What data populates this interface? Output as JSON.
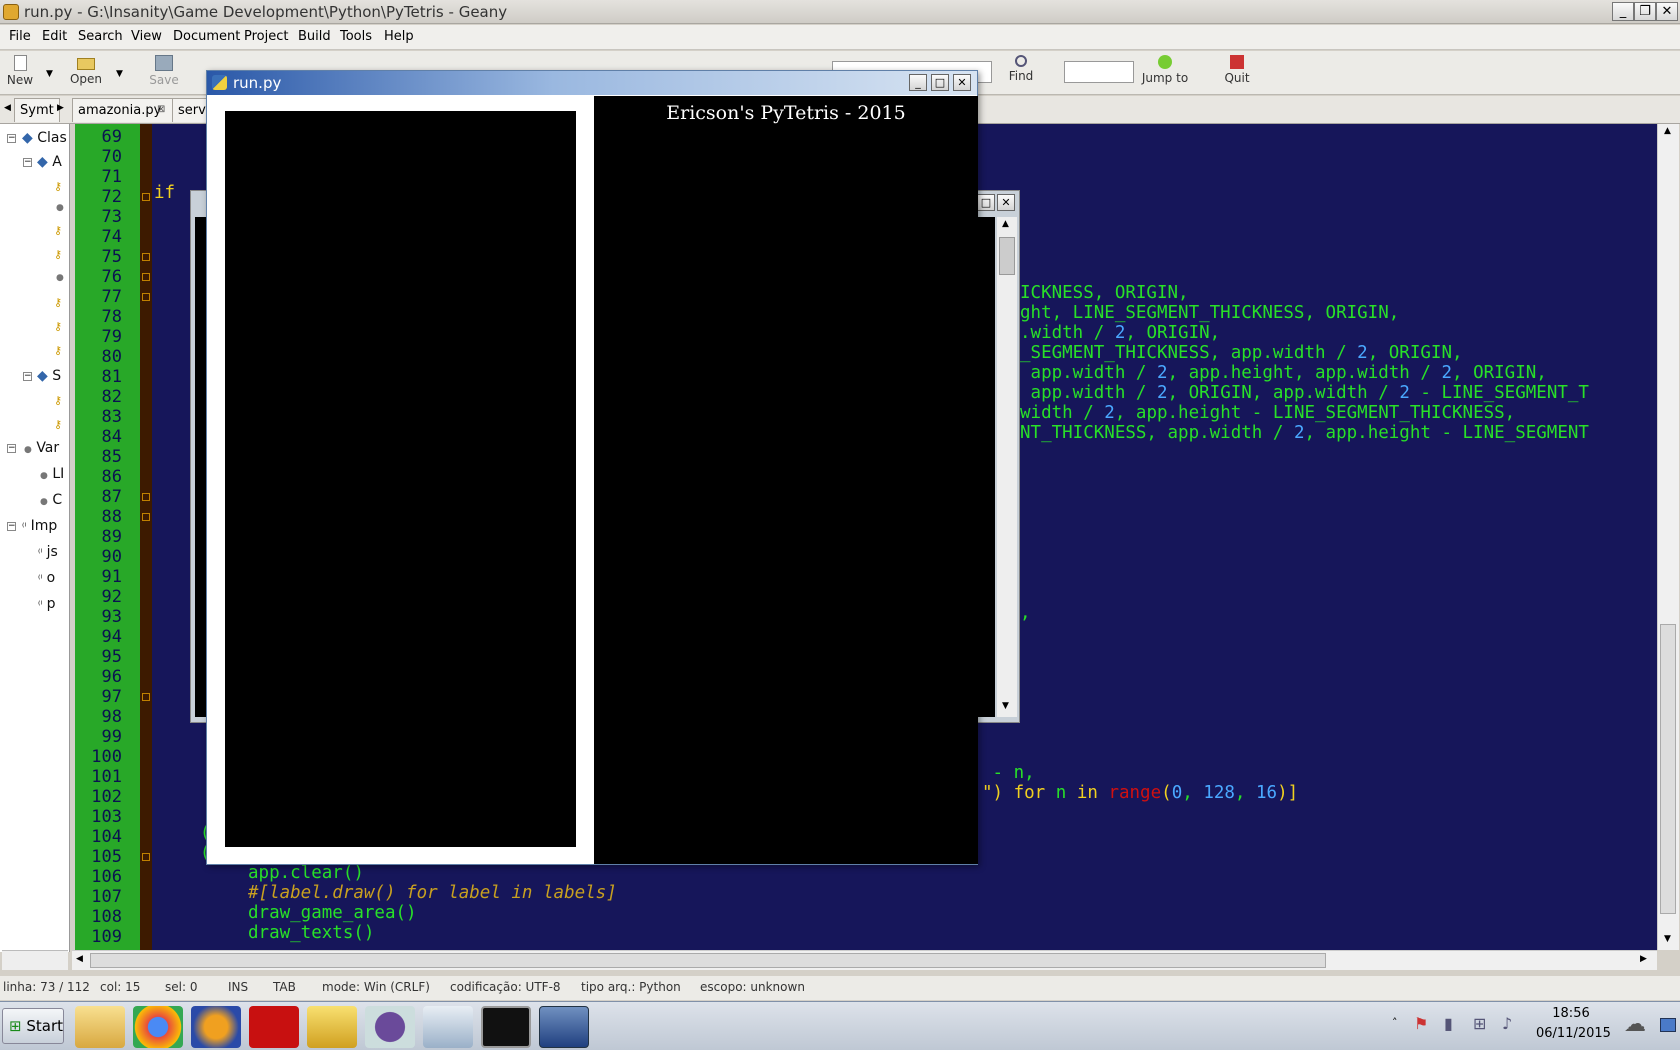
{
  "window": {
    "title": "run.py - G:\\Insanity\\Game Development\\Python\\PyTetris - Geany",
    "min": "_",
    "max": "❐",
    "close": "✕"
  },
  "menu": [
    "File",
    "Edit",
    "Search",
    "View",
    "Document",
    "Project",
    "Build",
    "Tools",
    "Help"
  ],
  "toolbar": {
    "new": "New",
    "open": "Open",
    "save": "Save",
    "find": "Find",
    "jump": "Jump to",
    "quit": "Quit"
  },
  "tabs": {
    "sidebar_tab": "Symt",
    "tab1": "amazonia.py",
    "tab2": "serv."
  },
  "sidebar": [
    "Clas",
    "A",
    "S",
    "Var",
    "LI",
    "C",
    "Imp",
    "js",
    "o",
    "p"
  ],
  "line_numbers": [
    "69",
    "70",
    "71",
    "72",
    "73",
    "74",
    "75",
    "76",
    "77",
    "78",
    "79",
    "80",
    "81",
    "82",
    "83",
    "84",
    "85",
    "86",
    "87",
    "88",
    "89",
    "90",
    "91",
    "92",
    "93",
    "94",
    "95",
    "96",
    "97",
    "98",
    "99",
    "100",
    "101",
    "102",
    "103",
    "104",
    "105",
    "106",
    "107",
    "108",
    "109"
  ],
  "code": {
    "l72": "if",
    "l77": "ICKNESS, ORIGIN,",
    "l78": "ght, LINE_SEGMENT_THICKNESS, ORIGIN,",
    "l79a": ".width / ",
    "l79b": "2",
    "l79c": ", ORIGIN,",
    "l80a": "_SEGMENT_THICKNESS, app.width / ",
    "l80b": "2",
    "l80c": ", ORIGIN,",
    "l81a": " app.width / ",
    "l81b": "2",
    "l81c": ", app.height, app.width / ",
    "l81d": "2",
    "l81e": ", ORIGIN,",
    "l82a": " app.width / ",
    "l82b": "2",
    "l82c": ", ORIGIN, app.width / ",
    "l82d": "2",
    "l82e": " - LINE_SEGMENT_T",
    "l83a": "width / ",
    "l83b": "2",
    "l83c": ", app.height - LINE_SEGMENT_THICKNESS,",
    "l84a": "NT_THICKNESS, app.width / ",
    "l84b": "2",
    "l84c": ", app.height - LINE_SEGMENT",
    "l94": ",",
    "l101": " - n,",
    "l102a": "\") ",
    "l102b": "for",
    "l102c": " n ",
    "l102d": "in",
    "l102e": " ",
    "l102f": "range",
    "l102g": "(",
    "l102h": "0",
    "l102i": ", ",
    "l102j": "128",
    "l102k": ", ",
    "l102l": "16",
    "l102m": ")]",
    "l104": "(",
    "l105": "(",
    "l106": "app.clear()",
    "l107": "#[label.draw() for label in labels]",
    "l108": "draw_game_area()",
    "l109": "draw_texts()"
  },
  "run_window": {
    "title": "run.py",
    "game_title": "Ericson's PyTetris - 2015"
  },
  "statusbar": {
    "line": "linha: 73 / 112",
    "col": "col: 15",
    "sel": "sel: 0",
    "ins": "INS",
    "tab": "TAB",
    "mode": "mode: Win (CRLF)",
    "enc": "codificação: UTF-8",
    "type": "tipo arq.: Python",
    "scope": "escopo: unknown"
  },
  "taskbar": {
    "start": "Start",
    "time": "18:56",
    "date": "06/11/2015"
  },
  "colors": {
    "editor_bg": "#16165a",
    "gutter": "#28a828",
    "code": "#28e028"
  }
}
